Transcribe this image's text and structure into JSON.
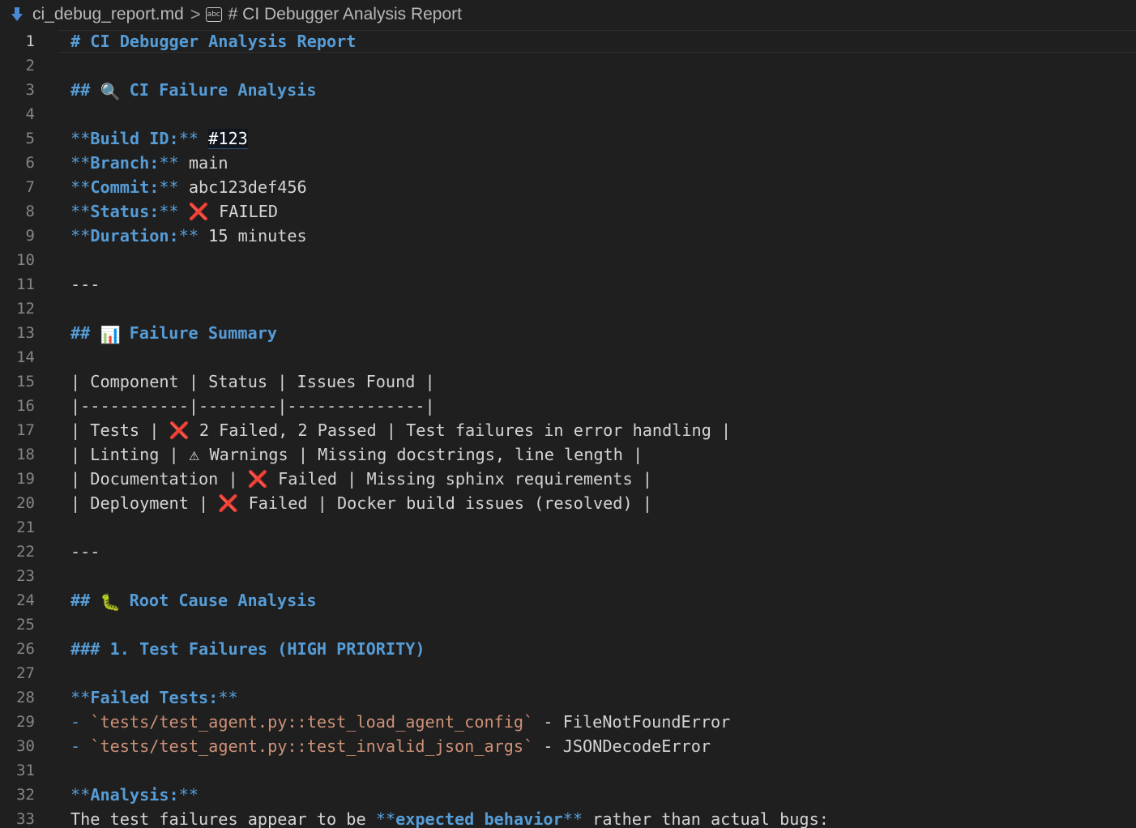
{
  "breadcrumb": {
    "filename": "ci_debug_report.md",
    "separator": ">",
    "symbol_label": "abc",
    "symbol_title": "# CI Debugger Analysis Report"
  },
  "editor": {
    "current_line": 1,
    "lines": [
      {
        "n": "1",
        "segments": [
          {
            "t": "# CI Debugger Analysis Report",
            "c": "head"
          }
        ]
      },
      {
        "n": "2",
        "segments": []
      },
      {
        "n": "3",
        "segments": [
          {
            "t": "## ",
            "c": "head"
          },
          {
            "t": "🔍",
            "c": "emoji-mag"
          },
          {
            "t": " CI Failure Analysis",
            "c": "head"
          }
        ]
      },
      {
        "n": "4",
        "segments": []
      },
      {
        "n": "5",
        "segments": [
          {
            "t": "**",
            "c": "mark"
          },
          {
            "t": "Build ID:",
            "c": "bold"
          },
          {
            "t": "**",
            "c": "mark"
          },
          {
            "t": " ",
            "c": "plain"
          },
          {
            "t": "#123",
            "c": "buildid"
          }
        ]
      },
      {
        "n": "6",
        "segments": [
          {
            "t": "**",
            "c": "mark"
          },
          {
            "t": "Branch:",
            "c": "bold"
          },
          {
            "t": "**",
            "c": "mark"
          },
          {
            "t": " main",
            "c": "plain"
          }
        ]
      },
      {
        "n": "7",
        "segments": [
          {
            "t": "**",
            "c": "mark"
          },
          {
            "t": "Commit:",
            "c": "bold"
          },
          {
            "t": "**",
            "c": "mark"
          },
          {
            "t": " abc123def456",
            "c": "plain"
          }
        ]
      },
      {
        "n": "8",
        "segments": [
          {
            "t": "**",
            "c": "mark"
          },
          {
            "t": "Status:",
            "c": "bold"
          },
          {
            "t": "**",
            "c": "mark"
          },
          {
            "t": " ",
            "c": "plain"
          },
          {
            "t": "❌",
            "c": "emoji-x"
          },
          {
            "t": " FAILED",
            "c": "plain"
          }
        ]
      },
      {
        "n": "9",
        "segments": [
          {
            "t": "**",
            "c": "mark"
          },
          {
            "t": "Duration:",
            "c": "bold"
          },
          {
            "t": "**",
            "c": "mark"
          },
          {
            "t": " 15 minutes",
            "c": "plain"
          }
        ]
      },
      {
        "n": "10",
        "segments": []
      },
      {
        "n": "11",
        "segments": [
          {
            "t": "---",
            "c": "plain"
          }
        ]
      },
      {
        "n": "12",
        "segments": []
      },
      {
        "n": "13",
        "segments": [
          {
            "t": "## ",
            "c": "head"
          },
          {
            "t": "📊",
            "c": "emoji-chart"
          },
          {
            "t": " Failure Summary",
            "c": "head"
          }
        ]
      },
      {
        "n": "14",
        "segments": []
      },
      {
        "n": "15",
        "segments": [
          {
            "t": "| Component | Status | Issues Found |",
            "c": "plain"
          }
        ]
      },
      {
        "n": "16",
        "segments": [
          {
            "t": "|-----------|--------|--------------|",
            "c": "plain"
          }
        ]
      },
      {
        "n": "17",
        "segments": [
          {
            "t": "| Tests | ",
            "c": "plain"
          },
          {
            "t": "❌",
            "c": "emoji-x"
          },
          {
            "t": " 2 Failed, 2 Passed | Test failures in error handling |",
            "c": "plain"
          }
        ]
      },
      {
        "n": "18",
        "segments": [
          {
            "t": "| Linting | ",
            "c": "plain"
          },
          {
            "t": "⚠",
            "c": "emoji-warn"
          },
          {
            "t": " Warnings | Missing docstrings, line length |",
            "c": "plain"
          }
        ]
      },
      {
        "n": "19",
        "segments": [
          {
            "t": "| Documentation | ",
            "c": "plain"
          },
          {
            "t": "❌",
            "c": "emoji-x"
          },
          {
            "t": " Failed | Missing sphinx requirements |",
            "c": "plain"
          }
        ]
      },
      {
        "n": "20",
        "segments": [
          {
            "t": "| Deployment | ",
            "c": "plain"
          },
          {
            "t": "❌",
            "c": "emoji-x"
          },
          {
            "t": " Failed | Docker build issues (resolved) |",
            "c": "plain"
          }
        ]
      },
      {
        "n": "21",
        "segments": []
      },
      {
        "n": "22",
        "segments": [
          {
            "t": "---",
            "c": "plain"
          }
        ]
      },
      {
        "n": "23",
        "segments": []
      },
      {
        "n": "24",
        "segments": [
          {
            "t": "## ",
            "c": "head"
          },
          {
            "t": "🐛",
            "c": "emoji-bug"
          },
          {
            "t": " Root Cause Analysis",
            "c": "head"
          }
        ]
      },
      {
        "n": "25",
        "segments": []
      },
      {
        "n": "26",
        "segments": [
          {
            "t": "### 1. Test Failures (HIGH PRIORITY)",
            "c": "head"
          }
        ]
      },
      {
        "n": "27",
        "segments": []
      },
      {
        "n": "28",
        "segments": [
          {
            "t": "**",
            "c": "mark"
          },
          {
            "t": "Failed Tests:",
            "c": "bold"
          },
          {
            "t": "**",
            "c": "mark"
          }
        ]
      },
      {
        "n": "29",
        "segments": [
          {
            "t": "- ",
            "c": "mark"
          },
          {
            "t": "`tests/test_agent.py::test_load_agent_config`",
            "c": "code"
          },
          {
            "t": " - FileNotFoundError",
            "c": "plain"
          }
        ]
      },
      {
        "n": "30",
        "segments": [
          {
            "t": "- ",
            "c": "mark"
          },
          {
            "t": "`tests/test_agent.py::test_invalid_json_args`",
            "c": "code"
          },
          {
            "t": " - JSONDecodeError",
            "c": "plain"
          }
        ]
      },
      {
        "n": "31",
        "segments": []
      },
      {
        "n": "32",
        "segments": [
          {
            "t": "**",
            "c": "mark"
          },
          {
            "t": "Analysis:",
            "c": "bold"
          },
          {
            "t": "**",
            "c": "mark"
          }
        ]
      },
      {
        "n": "33",
        "segments": [
          {
            "t": "The test failures appear to be ",
            "c": "plain"
          },
          {
            "t": "**",
            "c": "mark"
          },
          {
            "t": "expected behavior",
            "c": "bold"
          },
          {
            "t": "**",
            "c": "mark"
          },
          {
            "t": " rather than actual bugs:",
            "c": "plain"
          }
        ]
      }
    ]
  },
  "colors": {
    "background": "#1f1f1f",
    "heading": "#569cd6",
    "code_span": "#ce9178",
    "text": "#d4d4d4",
    "line_number": "#858585",
    "error_icon": "#e0201c"
  }
}
